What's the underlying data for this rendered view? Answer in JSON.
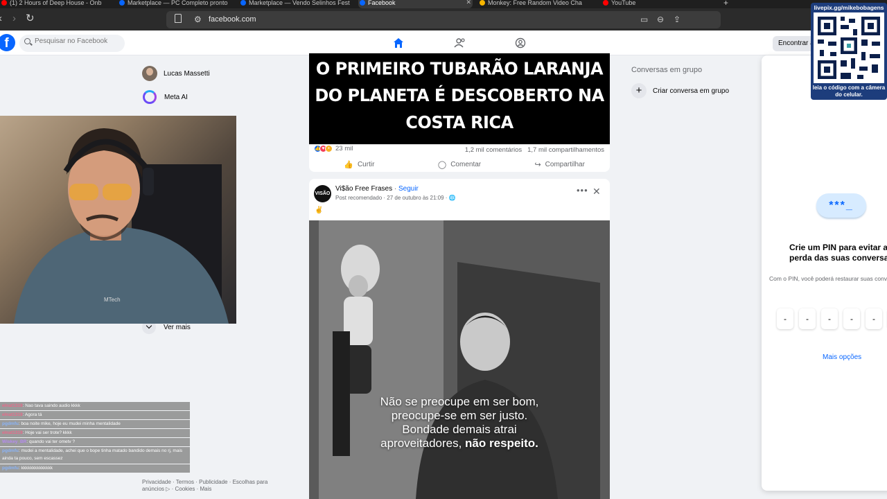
{
  "browser": {
    "tabs": [
      {
        "title": "(1) 2 Hours of Deep House - Onb",
        "color": "#ff0000"
      },
      {
        "title": "Marketplace — PC Completo pronto",
        "color": "#0866ff"
      },
      {
        "title": "Marketplace — Vendo Selinhos Fest",
        "color": "#0866ff"
      },
      {
        "title": "Facebook",
        "color": "#0866ff"
      },
      {
        "title": "Monkey: Free Random Video Cha",
        "color": "#f7b500"
      },
      {
        "title": "YouTube",
        "color": "#ff0000"
      }
    ],
    "new_tab": "+",
    "url": "facebook.com"
  },
  "facebook": {
    "logo": "f",
    "search_placeholder": "Pesquisar no Facebook",
    "nav": {
      "home_icon": "home-icon",
      "friends_icon": "friends-icon",
      "groups_icon": "groups-icon"
    },
    "find_button": "Encontrar amigos"
  },
  "sidebar": {
    "items": [
      {
        "label": "Lucas Massetti",
        "icon": "avatar"
      },
      {
        "label": "Meta AI",
        "icon": "meta-ai-icon"
      },
      {
        "label": "Ver mais",
        "icon": "chevron-down-icon"
      }
    ],
    "footer": "Privacidade · Termos · Publicidade · Escolhas para anúncios ▷ · Cookies · Mais"
  },
  "chat": [
    {
      "user": "elnat1319",
      "text": ": Nao tava saindo audio kkkk",
      "user_color": "#e86a8a"
    },
    {
      "user": "elnat1319",
      "text": ": Agora tá",
      "user_color": "#e86a8a"
    },
    {
      "user": "pgdmfu",
      "text": ": boa noite mike, hoje eu mudei minha mentalidade",
      "user_color": "#8ab4f8"
    },
    {
      "user": "elnat1319",
      "text": ": Hoje vai ser trote? kkkk",
      "user_color": "#e86a8a"
    },
    {
      "user": "Wiskey_BR",
      "text": ": quando vai ter ometv ?",
      "user_color": "#b58af0"
    },
    {
      "user": "pgdmfu",
      "text": ": mudei a mentalidade, achei que o bope tinha matado bandido demais no rj, mais ainda ta pouco, sem escassez",
      "user_color": "#8ab4f8"
    },
    {
      "user": "pgdmfu",
      "text": ": kkkkkkkkkkkkkk",
      "user_color": "#8ab4f8"
    }
  ],
  "post1": {
    "headline": "O PRIMEIRO TUBARÃO LARANJA DO PLANETA É DESCOBERTO NA COSTA RICA",
    "reactions_count": "23 mil",
    "comments": "1,2 mil comentários",
    "shares": "1,7 mil compartilhamentos",
    "actions": {
      "like": "Curtir",
      "comment": "Comentar",
      "share": "Compartilhar"
    }
  },
  "post2": {
    "page_avatar_text": "VISÃO FREE",
    "page_name": "Vi$ão Free Frases",
    "separator": " · ",
    "follow": "Seguir",
    "meta": "Post recomendado · 27 de outubro às 21:09 · 🌐",
    "emoji": "✌️",
    "quote_lines": [
      "Não se preocupe em ser bom,",
      "preocupe-se em ser justo.",
      "Bondade demais atrai"
    ],
    "quote_last_start": "aproveitadores, ",
    "quote_last_bold": "não respeito."
  },
  "right_column": {
    "title": "Conversas em grupo",
    "create_label": "Criar conversa em grupo"
  },
  "pin_panel": {
    "badge": "***_",
    "title": "Crie um PIN para evitar a perda das suas conversas",
    "description": "Com o PIN, você poderá restaurar suas conversas quando trocar de dispositivo.",
    "digits": [
      "-",
      "-",
      "-",
      "-",
      "-",
      "-"
    ],
    "more_options": "Mais opções"
  },
  "qr": {
    "url": "livepix.gg/mikebobagens",
    "caption": "leia o código com a câmera do celular."
  }
}
